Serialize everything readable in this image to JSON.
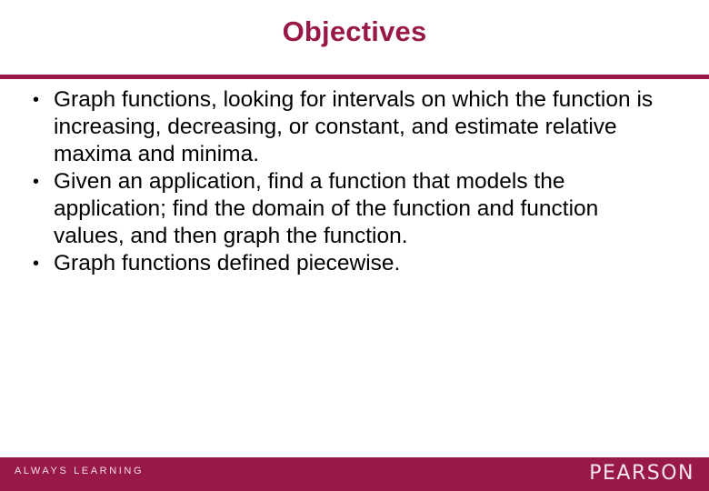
{
  "slide": {
    "title": "Objectives",
    "accent_color": "#981848",
    "bullets": [
      "Graph functions, looking for intervals on which the function is increasing, decreasing, or constant, and estimate relative maxima and minima.",
      "Given an application, find a function that models the application; find the domain of the function and function values, and then graph the function.",
      "Graph functions defined piecewise."
    ]
  },
  "footer": {
    "tagline": "ALWAYS LEARNING",
    "brand": "PEARSON"
  }
}
